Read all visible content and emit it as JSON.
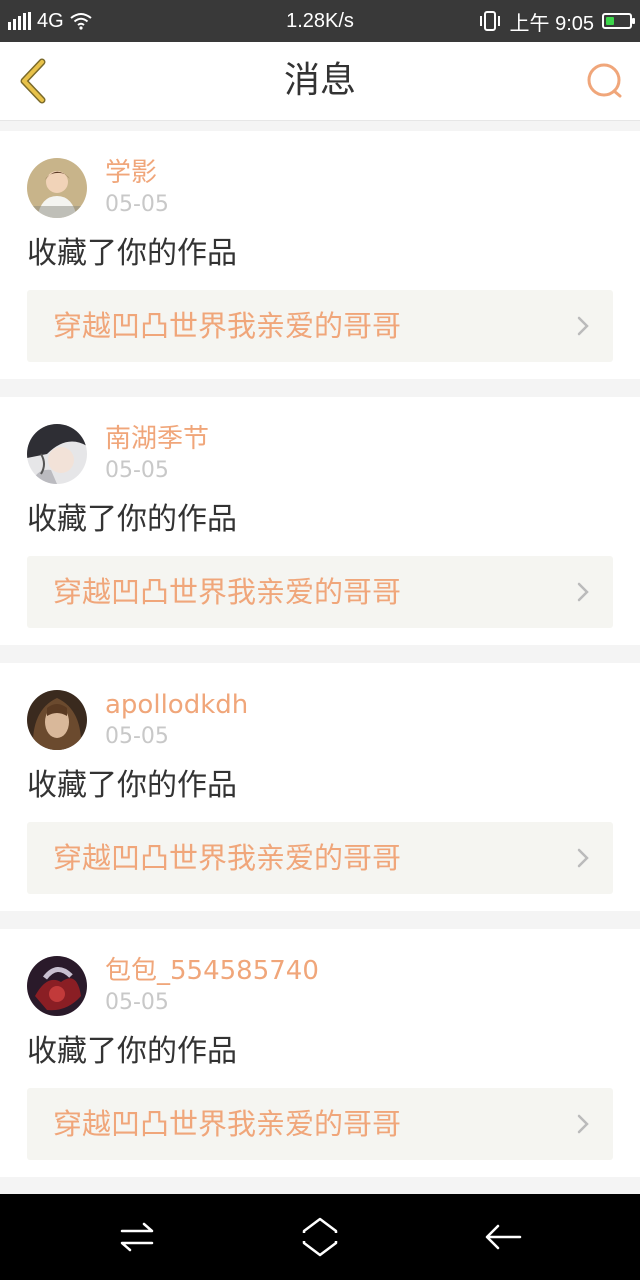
{
  "status_bar": {
    "network": "4G",
    "speed": "1.28K/s",
    "time": "上午 9:05"
  },
  "header": {
    "title": "消息"
  },
  "messages": [
    {
      "username": "学影",
      "date": "05-05",
      "action": "收藏了你的作品",
      "work_title": "穿越凹凸世界我亲爱的哥哥"
    },
    {
      "username": "南湖季节",
      "date": "05-05",
      "action": "收藏了你的作品",
      "work_title": "穿越凹凸世界我亲爱的哥哥"
    },
    {
      "username": "apollodkdh",
      "date": "05-05",
      "action": "收藏了你的作品",
      "work_title": "穿越凹凸世界我亲爱的哥哥"
    },
    {
      "username": "包包_554585740",
      "date": "05-05",
      "action": "收藏了你的作品",
      "work_title": "穿越凹凸世界我亲爱的哥哥"
    }
  ],
  "colors": {
    "accent": "#f0a67a",
    "back_icon": "#e8c24a",
    "status_bar_bg": "#393939",
    "battery": "#3dd64b"
  },
  "icons": {
    "back": "back-arrow-icon",
    "search": "search-icon",
    "chevron": "chevron-right-icon",
    "nav_menu": "menu-swap-icon",
    "nav_home": "home-icon",
    "nav_back": "back-icon"
  }
}
